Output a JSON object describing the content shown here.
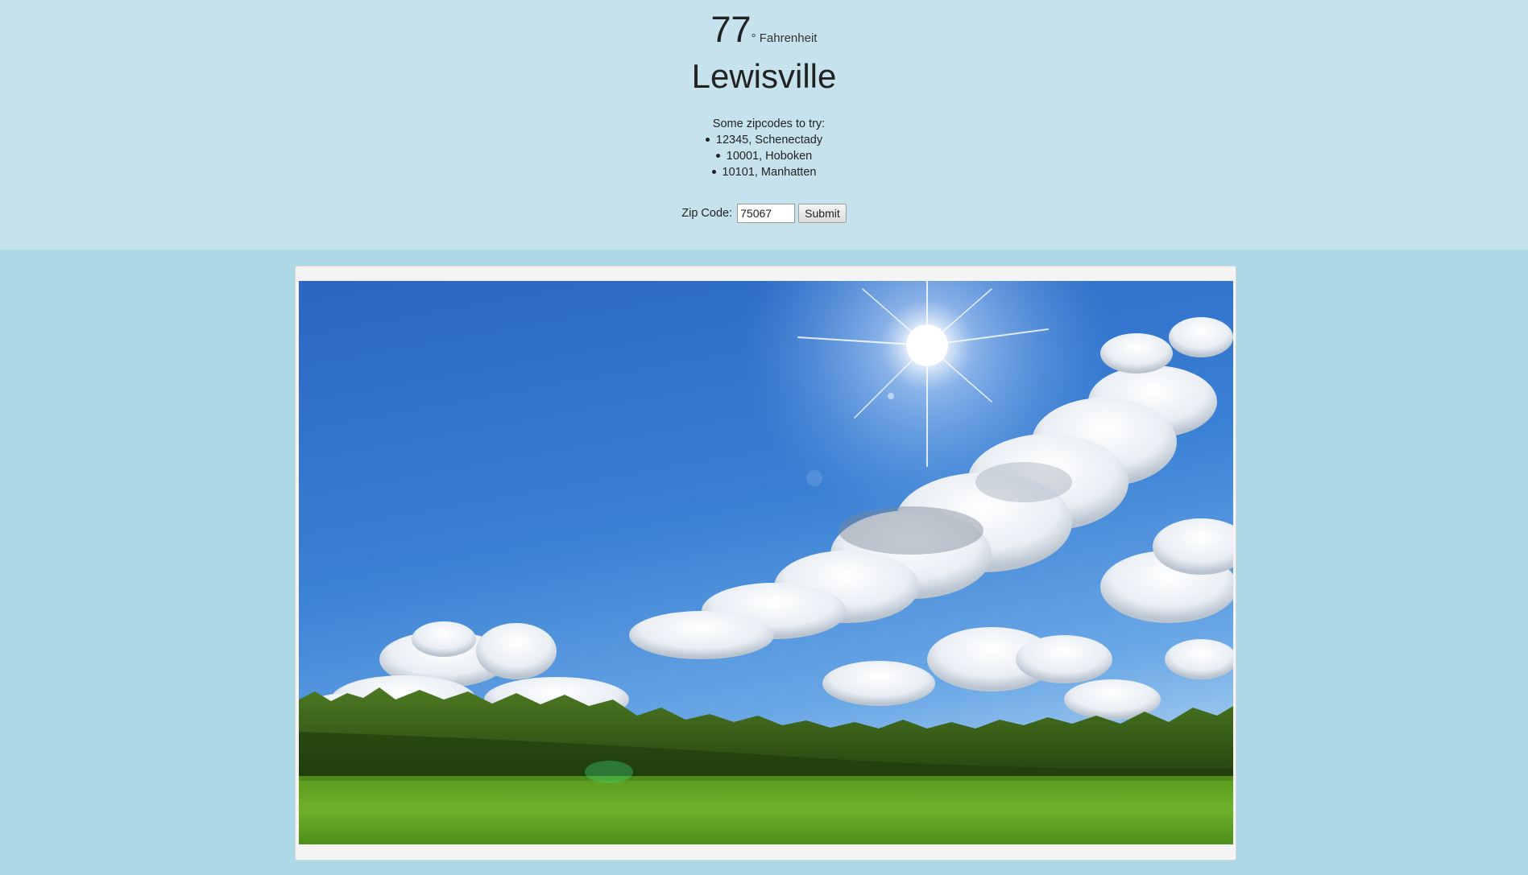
{
  "weather": {
    "temperature": "77",
    "unit": "° Fahrenheit",
    "city": "Lewisville"
  },
  "suggestions": {
    "title": "Some zipcodes to try:",
    "items": [
      "12345, Schenectady",
      "10001, Hoboken",
      "10101, Manhatten"
    ]
  },
  "form": {
    "label": "Zip Code:",
    "value": "75067",
    "submit_label": "Submit"
  },
  "image": {
    "subject": "sunny sky over grassy field"
  }
}
